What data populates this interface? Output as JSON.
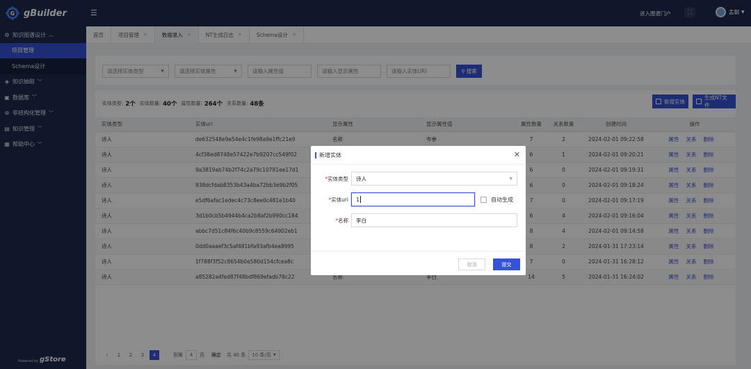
{
  "app": {
    "logo_text": "gBuilder",
    "powered_by": "Powered by",
    "powered_brand": "gStore"
  },
  "sidebar": {
    "items": [
      {
        "label": "知识图谱设计",
        "icon": "gear-icon",
        "expanded": true
      },
      {
        "label": "知识抽取",
        "icon": "extract-icon"
      },
      {
        "label": "数据库",
        "icon": "database-icon"
      },
      {
        "label": "非结构化管理",
        "icon": "unstructured-icon"
      },
      {
        "label": "知识管理",
        "icon": "knowledge-icon"
      },
      {
        "label": "帮助中心",
        "icon": "help-icon"
      }
    ],
    "subitems": [
      "项目管理",
      "Schema设计"
    ]
  },
  "header": {
    "toggle_icon": "menu-toggle-icon",
    "portal": "进入图谱门户",
    "fullscreen_icon": "fullscreen-icon",
    "user": "孟朝"
  },
  "tabs": [
    {
      "label": "首页",
      "closable": false
    },
    {
      "label": "项目管理",
      "closable": true
    },
    {
      "label": "数据录入",
      "closable": true,
      "active": true
    },
    {
      "label": "NT生成日志",
      "closable": true
    },
    {
      "label": "Schema设计",
      "closable": true
    }
  ],
  "filters": {
    "entity_type": "请选择实体类型",
    "entity_attr": "请选择实体属性",
    "attr_value": "请输入属性值",
    "display_attr": "请输入显示属性",
    "entity_uri": "请输入实体URI",
    "search": "搜索"
  },
  "stats": {
    "type_label": "实体类型:",
    "type_value": "2个",
    "count_label": "实体数量:",
    "count_value": "40个",
    "attr_label": "属性数量:",
    "attr_value": "264个",
    "rel_label": "关系数量:",
    "rel_value": "48条"
  },
  "actions": {
    "add_entity": "新增实体",
    "gen_nt": "生成NT文件"
  },
  "table": {
    "headers": [
      "实体类型",
      "实体uri",
      "显示属性",
      "显示属性值",
      "属性数量",
      "关系数量",
      "创建时间",
      "操作"
    ],
    "rows": [
      [
        "诗人",
        "de632548e9e54e4c1fe98a9e1ffc21e9",
        "名称",
        "岑参",
        "7",
        "2",
        "2024-02-01 09:22:58"
      ],
      [
        "诗人",
        "4cf38ed8748e57422e7b9207cc549f02",
        "",
        "",
        "6",
        "1",
        "2024-02-01 09:20:21"
      ],
      [
        "诗人",
        "9a3819ab74b2f74c2a79c10781ee17d1",
        "",
        "",
        "6",
        "0",
        "2024-02-01 09:19:31"
      ],
      [
        "诗人",
        "938dcfdab8353b43a4ba72bb3e9b2f05",
        "",
        "",
        "6",
        "0",
        "2024-02-01 09:18:24"
      ],
      [
        "诗人",
        "e5df6afac1edec4c73c8ee0c481e1b40",
        "",
        "",
        "7",
        "0",
        "2024-02-01 09:17:19"
      ],
      [
        "诗人",
        "3d1b0cb5b4944b4ca2b8af2b990cc184",
        "",
        "",
        "6",
        "4",
        "2024-02-01 09:16:04"
      ],
      [
        "诗人",
        "abbc7d51c84f6c40b9c8559c64902eb1",
        "",
        "",
        "8",
        "4",
        "2024-02-01 09:14:58"
      ],
      [
        "诗人",
        "0dd0aaaef3c5af481bfa93afb4ea8995",
        "",
        "",
        "8",
        "2",
        "2024-01-31 17:23:14"
      ],
      [
        "诗人",
        "1f788f3f52c8654b0e580d154cfcea8c",
        "",
        "",
        "7",
        "0",
        "2024-01-31 16:28:12"
      ],
      [
        "诗人",
        "a85282a4fed87f48bdf869efadb78c22",
        "名称",
        "李白",
        "14",
        "5",
        "2024-01-31 16:24:02"
      ]
    ],
    "ops": [
      "属性",
      "关系",
      "删除"
    ]
  },
  "pagination": {
    "pages": [
      "1",
      "2",
      "3",
      "4"
    ],
    "current": "4",
    "goto_label": "到第",
    "goto_value": "4",
    "page_unit": "页",
    "confirm": "确定",
    "total": "共 40 条",
    "page_size": "10 条/页"
  },
  "modal": {
    "title": "新增实体",
    "type_label": "实体类型",
    "type_value": "诗人",
    "uri_label": "实体uri",
    "uri_value": "1",
    "auto_label": "自动生成",
    "name_label": "名称",
    "name_value": "李白",
    "cancel": "取消",
    "submit": "提交"
  }
}
